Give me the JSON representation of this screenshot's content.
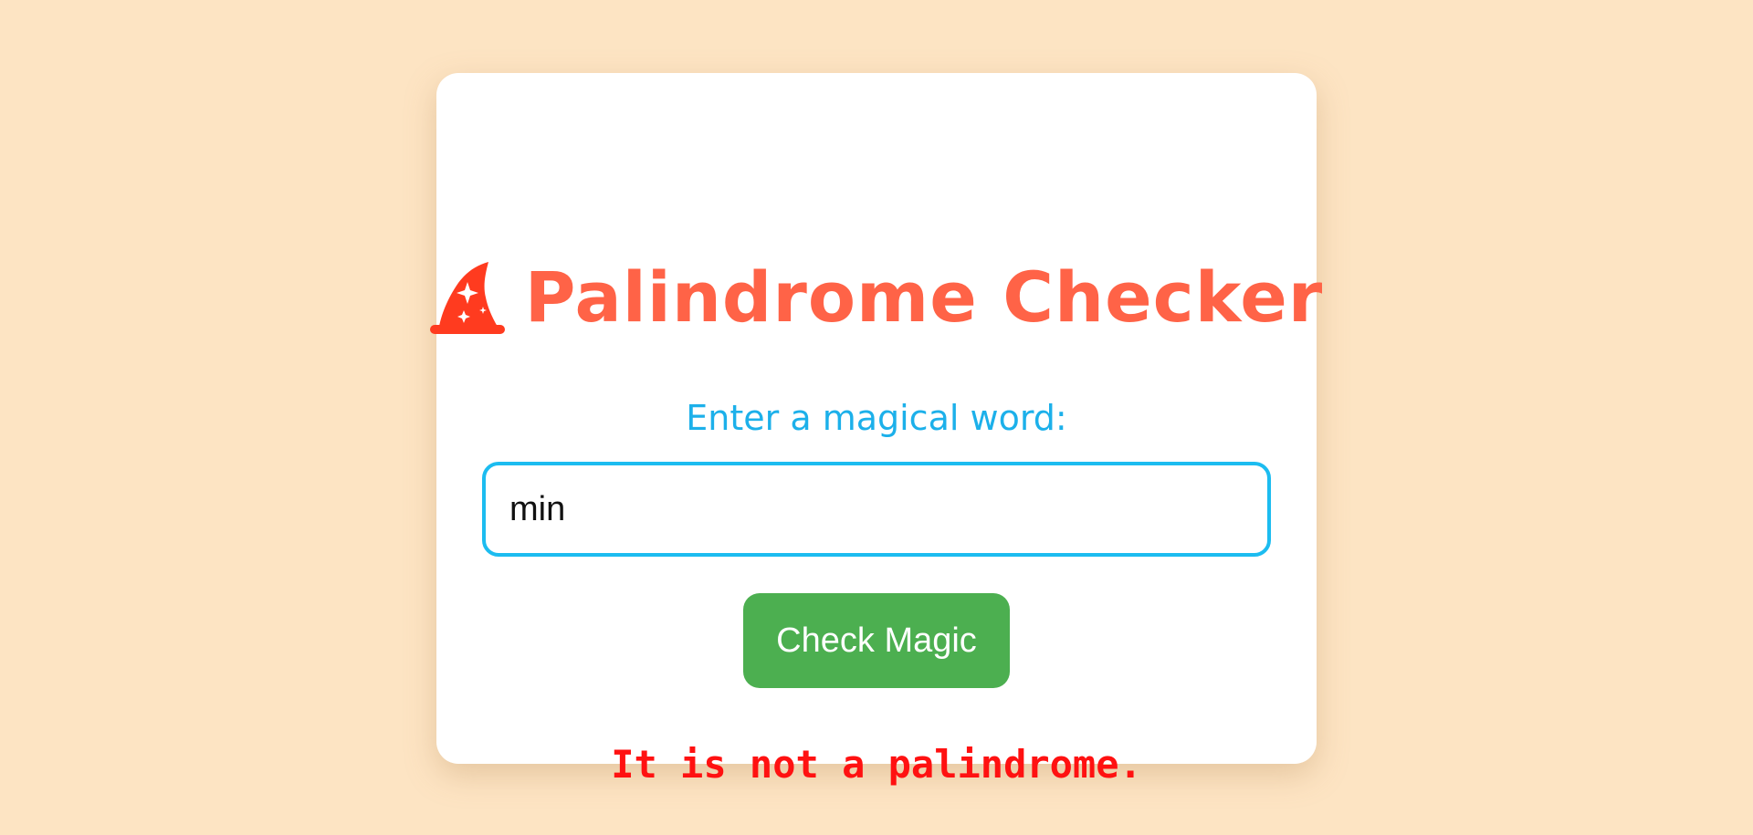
{
  "header": {
    "icon": "wizard-hat-icon",
    "title": "Palindrome Checker"
  },
  "form": {
    "label": "Enter a magical word:",
    "input_value": "min",
    "button_label": "Check Magic"
  },
  "result": {
    "message": "It is not a palindrome."
  },
  "colors": {
    "background": "#fde4c3",
    "card": "#ffffff",
    "title": "#ff6347",
    "label": "#1cb0ea",
    "input_border": "#1cbcf0",
    "button": "#4caf50",
    "result": "#ff1111",
    "icon": "#ff3b1f"
  }
}
